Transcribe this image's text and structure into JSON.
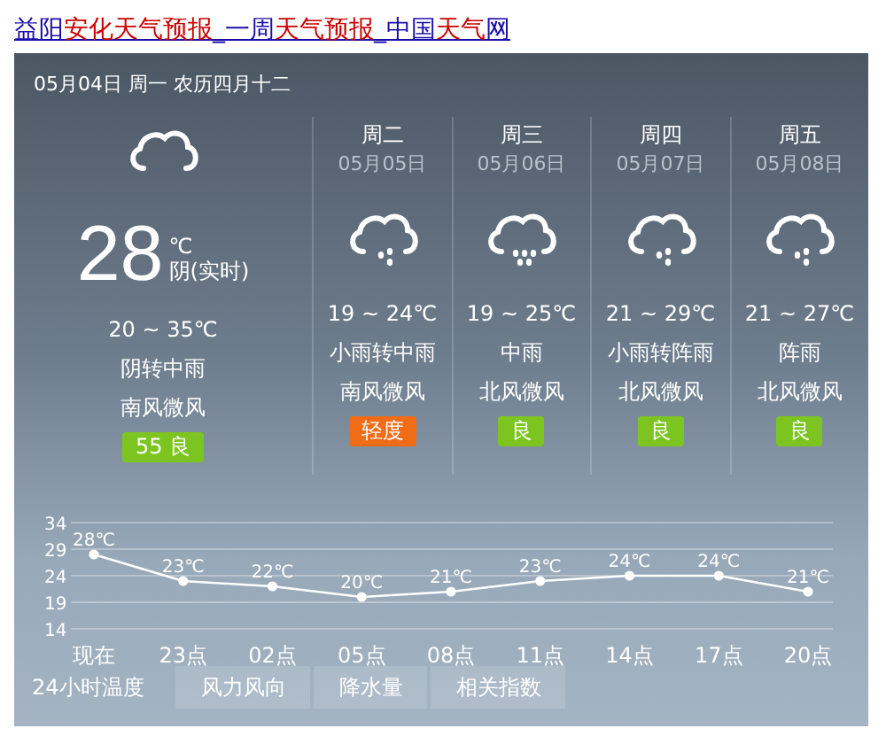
{
  "title_link": [
    {
      "text": "益阳",
      "highlight": false
    },
    {
      "text": "安化天气预报",
      "highlight": true
    },
    {
      "text": "_一周",
      "highlight": false
    },
    {
      "text": "天气预报",
      "highlight": true
    },
    {
      "text": "_中国",
      "highlight": false
    },
    {
      "text": "天气",
      "highlight": true
    },
    {
      "text": "网",
      "highlight": false
    }
  ],
  "header_date": "05月04日 周一 农历四月十二",
  "today": {
    "temp": "28",
    "unit": "℃",
    "condition_now": "阴(实时)",
    "range": "20 ~ 35℃",
    "weather": "阴转中雨",
    "wind": "南风微风",
    "aqi": "55 良",
    "color": "#7cc520"
  },
  "days": [
    {
      "day": "周二",
      "date": "05月05日",
      "kind": "rain",
      "range": "19 ~ 24℃",
      "weather": "小雨转中雨",
      "wind": "南风微风",
      "aqi": "轻度",
      "color": "#f06c16"
    },
    {
      "day": "周三",
      "date": "05月06日",
      "kind": "heavy-rain",
      "range": "19 ~ 25℃",
      "weather": "中雨",
      "wind": "北风微风",
      "aqi": "良",
      "color": "#7cc520"
    },
    {
      "day": "周四",
      "date": "05月07日",
      "kind": "rain",
      "range": "21 ~ 29℃",
      "weather": "小雨转阵雨",
      "wind": "北风微风",
      "aqi": "良",
      "color": "#7cc520"
    },
    {
      "day": "周五",
      "date": "05月08日",
      "kind": "rain",
      "range": "21 ~ 27℃",
      "weather": "阵雨",
      "wind": "北风微风",
      "aqi": "良",
      "color": "#7cc520"
    }
  ],
  "chart_data": {
    "type": "line",
    "categories": [
      "现在",
      "23点",
      "02点",
      "05点",
      "08点",
      "11点",
      "14点",
      "17点",
      "20点"
    ],
    "series": [
      {
        "color": "#ffffff",
        "marker": "circle",
        "values": [
          28,
          23,
          22,
          20,
          21,
          23,
          24,
          24,
          21
        ]
      }
    ],
    "value_labels": [
      "28℃",
      "23℃",
      "22℃",
      "20℃",
      "21℃",
      "23℃",
      "24℃",
      "24℃",
      "21℃"
    ],
    "ylim": [
      14,
      34
    ],
    "yticks": [
      14,
      19,
      24,
      29,
      34
    ],
    "grid": true
  },
  "tabs": [
    {
      "label": "24小时温度",
      "selected": true
    },
    {
      "label": "风力风向",
      "selected": false
    },
    {
      "label": "降水量",
      "selected": false
    },
    {
      "label": "相关指数",
      "selected": false
    }
  ]
}
